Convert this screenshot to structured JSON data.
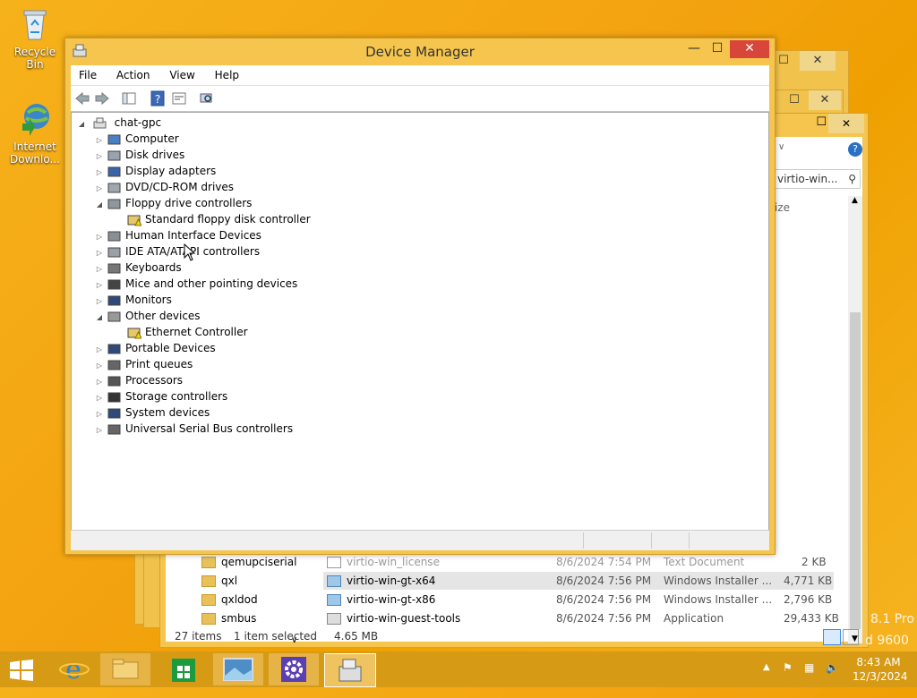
{
  "desktop": {
    "icons": [
      {
        "label": "Recycle Bin",
        "icon": "recycle-bin-icon"
      },
      {
        "label": "Internet Downlo...",
        "icon": "internet-download-manager-icon"
      }
    ],
    "watermark": [
      "8.1 Pro",
      "d 9600"
    ]
  },
  "explorer": {
    "search_placeholder": "virtio-win...",
    "column_size": "ize",
    "folders": [
      "qemupciserial",
      "qxl",
      "qxldod",
      "smbus"
    ],
    "files": [
      {
        "name": "virtio-win_license",
        "date": "8/6/2024 7:54 PM",
        "type": "Text Document",
        "size": "2 KB"
      },
      {
        "name": "virtio-win-gt-x64",
        "date": "8/6/2024 7:56 PM",
        "type": "Windows Installer ...",
        "size": "4,771 KB"
      },
      {
        "name": "virtio-win-gt-x86",
        "date": "8/6/2024 7:56 PM",
        "type": "Windows Installer ...",
        "size": "2,796 KB"
      },
      {
        "name": "virtio-win-guest-tools",
        "date": "8/6/2024 7:56 PM",
        "type": "Application",
        "size": "29,433 KB"
      }
    ],
    "status_items": "27 items",
    "status_selected": "1 item selected",
    "status_size": "4.65 MB"
  },
  "device_manager": {
    "title": "Device Manager",
    "menu": [
      "File",
      "Action",
      "View",
      "Help"
    ],
    "root": "chat-gpc",
    "nodes": [
      {
        "label": "Computer",
        "expanded": false
      },
      {
        "label": "Disk drives",
        "expanded": false
      },
      {
        "label": "Display adapters",
        "expanded": false
      },
      {
        "label": "DVD/CD-ROM drives",
        "expanded": false
      },
      {
        "label": "Floppy drive controllers",
        "expanded": true
      },
      {
        "label": "Standard floppy disk controller",
        "child": true
      },
      {
        "label": "Human Interface Devices",
        "expanded": false
      },
      {
        "label": "IDE ATA/ATAPI controllers",
        "expanded": false
      },
      {
        "label": "Keyboards",
        "expanded": false
      },
      {
        "label": "Mice and other pointing devices",
        "expanded": false
      },
      {
        "label": "Monitors",
        "expanded": false
      },
      {
        "label": "Other devices",
        "expanded": true
      },
      {
        "label": "Ethernet Controller",
        "child": true
      },
      {
        "label": "Portable Devices",
        "expanded": false
      },
      {
        "label": "Print queues",
        "expanded": false
      },
      {
        "label": "Processors",
        "expanded": false
      },
      {
        "label": "Storage controllers",
        "expanded": false
      },
      {
        "label": "System devices",
        "expanded": false
      },
      {
        "label": "Universal Serial Bus controllers",
        "expanded": false
      }
    ]
  },
  "taskbar": {
    "time": "8:43 AM",
    "date": "12/3/2024"
  }
}
